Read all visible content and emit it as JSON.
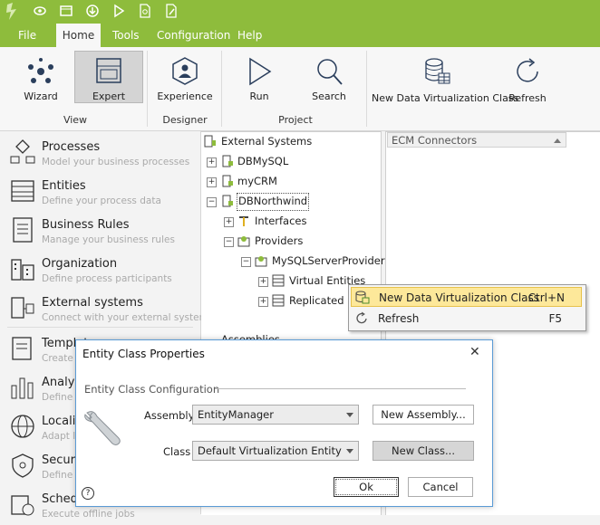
{
  "menu": {
    "tabs": [
      "File",
      "Home",
      "Tools",
      "Configuration",
      "Help"
    ],
    "active_tab": "Home"
  },
  "ribbon": {
    "buttons": {
      "wizard": "Wizard",
      "expert": "Expert",
      "experience": "Experience",
      "run": "Run",
      "search": "Search",
      "new_dv_class": "New Data Virtualization Class",
      "refresh": "Refresh"
    },
    "groups": {
      "view": "View",
      "designer": "Designer",
      "project": "Project"
    }
  },
  "leftnav": {
    "items": [
      {
        "title": "Processes",
        "subtitle": "Model your business processes"
      },
      {
        "title": "Entities",
        "subtitle": "Define your process data"
      },
      {
        "title": "Business Rules",
        "subtitle": "Manage your business rules"
      },
      {
        "title": "Organization",
        "subtitle": "Define process participants"
      },
      {
        "title": "External systems",
        "subtitle": "Connect with your external systems"
      },
      {
        "title": "Templat",
        "subtitle": "Create le"
      },
      {
        "title": "Analysis",
        "subtitle": "Define p"
      },
      {
        "title": "Localiz",
        "subtitle": "Adapt la"
      },
      {
        "title": "Security",
        "subtitle": "Define y"
      },
      {
        "title": "Schedu",
        "subtitle": "Execute offline jobs"
      }
    ]
  },
  "tree": {
    "root": "External Systems",
    "nodes": {
      "dbmysql": "DBMySQL",
      "mycrm": "myCRM",
      "dbnorthwind": "DBNorthwind",
      "interfaces": "Interfaces",
      "providers": "Providers",
      "mysqlserverprovider": "MySQLServerProvider",
      "virtual_entities": "Virtual Entities",
      "replicated": "Replicated E",
      "assemblies": "Assemblies"
    }
  },
  "right_panel": {
    "header": "ECM Connectors"
  },
  "context_menu": {
    "items": [
      {
        "label": "New Data Virtualization Class",
        "shortcut": "Ctrl+N"
      },
      {
        "label": "Refresh",
        "shortcut": "F5"
      }
    ]
  },
  "dialog": {
    "title": "Entity Class Properties",
    "section_label": "Entity Class Configuration",
    "assembly_label": "Assembly",
    "assembly_value": "EntityManager",
    "new_assembly_button": "New Assembly...",
    "class_label": "Class",
    "class_value": "Default Virtualization Entity",
    "new_class_button": "New Class...",
    "ok_button": "Ok",
    "cancel_button": "Cancel",
    "close_glyph": "✕",
    "help_glyph": "?"
  },
  "colors": {
    "brand_green": "#8ebc3c",
    "highlight": "#fde89a",
    "dialog_border": "#5a9bd5"
  }
}
